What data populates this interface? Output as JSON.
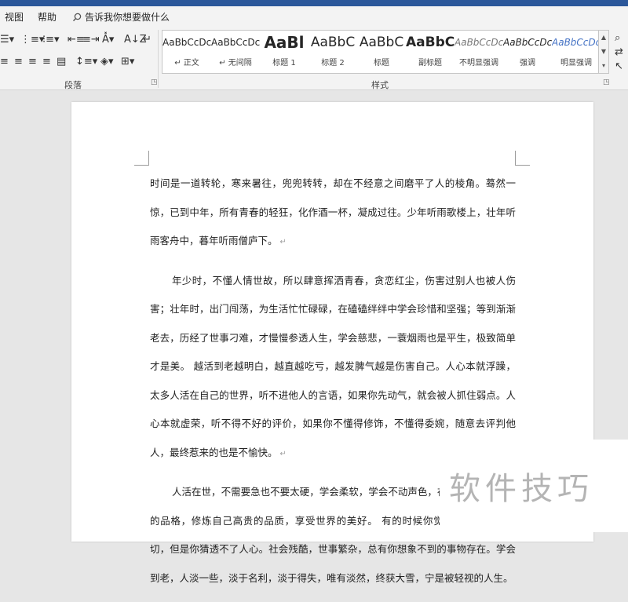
{
  "menu": {
    "view": "视图",
    "help": "帮助",
    "tell_me": "告诉我你想要做什么"
  },
  "ribbon": {
    "paragraph_group": "段落",
    "styles_group": "样式",
    "styles": [
      {
        "preview": "AaBbCcDc",
        "name": "↵ 正文"
      },
      {
        "preview": "AaBbCcDc",
        "name": "↵ 无间隔"
      },
      {
        "preview": "AaBl",
        "name": "标题 1"
      },
      {
        "preview": "AaBbC",
        "name": "标题 2"
      },
      {
        "preview": "AaBbC",
        "name": "标题"
      },
      {
        "preview": "AaBbC",
        "name": "副标题"
      },
      {
        "preview": "AaBbCcDc",
        "name": "不明显强调"
      },
      {
        "preview": "AaBbCcDc",
        "name": "强调"
      },
      {
        "preview": "AaBbCcDc",
        "name": "明显强调"
      }
    ]
  },
  "document": {
    "paragraphs": [
      "时间是一道转轮，寒来暑往，兜兜转转，却在不经意之间磨平了人的棱角。蓦然一惊，已到中年，所有青春的轻狂，化作酒一杯，凝成过往。少年听雨歌楼上，壮年听雨客舟中，暮年听雨僧庐下。",
      "年少时，不懂人情世故，所以肆意挥洒青春，贪恋红尘，伤害过别人也被人伤害；壮年时，出门闯荡，为生活忙忙碌碌，在磕磕绊绊中学会珍惜和坚强；等到渐渐老去，历经了世事刁难，才慢慢参透人生，学会慈悲，一蓑烟雨也是平生，极致简单才是美。 越活到老越明白，越直越吃亏，越发脾气越是伤害自己。人心本就浮躁，太多人活在自己的世界，听不进他人的言语，如果你先动气，就会被人抓住弱点。人心本就虚荣，听不得不好的评价，如果你不懂得修饰，不懂得委婉，随意去评判他人，最终惹来的也是不愉快。",
      "人活在世，不需要急也不要太硬，学会柔软，学会不动声色，在安静中修炼自己的品格，修炼自己高贵的品质，享受世界的美好。 有的时候你觉得自己看透了一切，但是你猜透不了人心。社会残酷，世事繁杂，总有你想象不到的事物存在。学会到老，人淡一些，淡于名利，淡于得失，唯有淡然，终获大雪，宁是被轻视的人生。"
    ],
    "paragraph_mark": "↵"
  },
  "watermark": {
    "text": "软件技巧"
  },
  "colors": {
    "title_bar": "#2b579a",
    "ribbon_bg": "#f3f3f3",
    "canvas": "#e6e6e6"
  }
}
